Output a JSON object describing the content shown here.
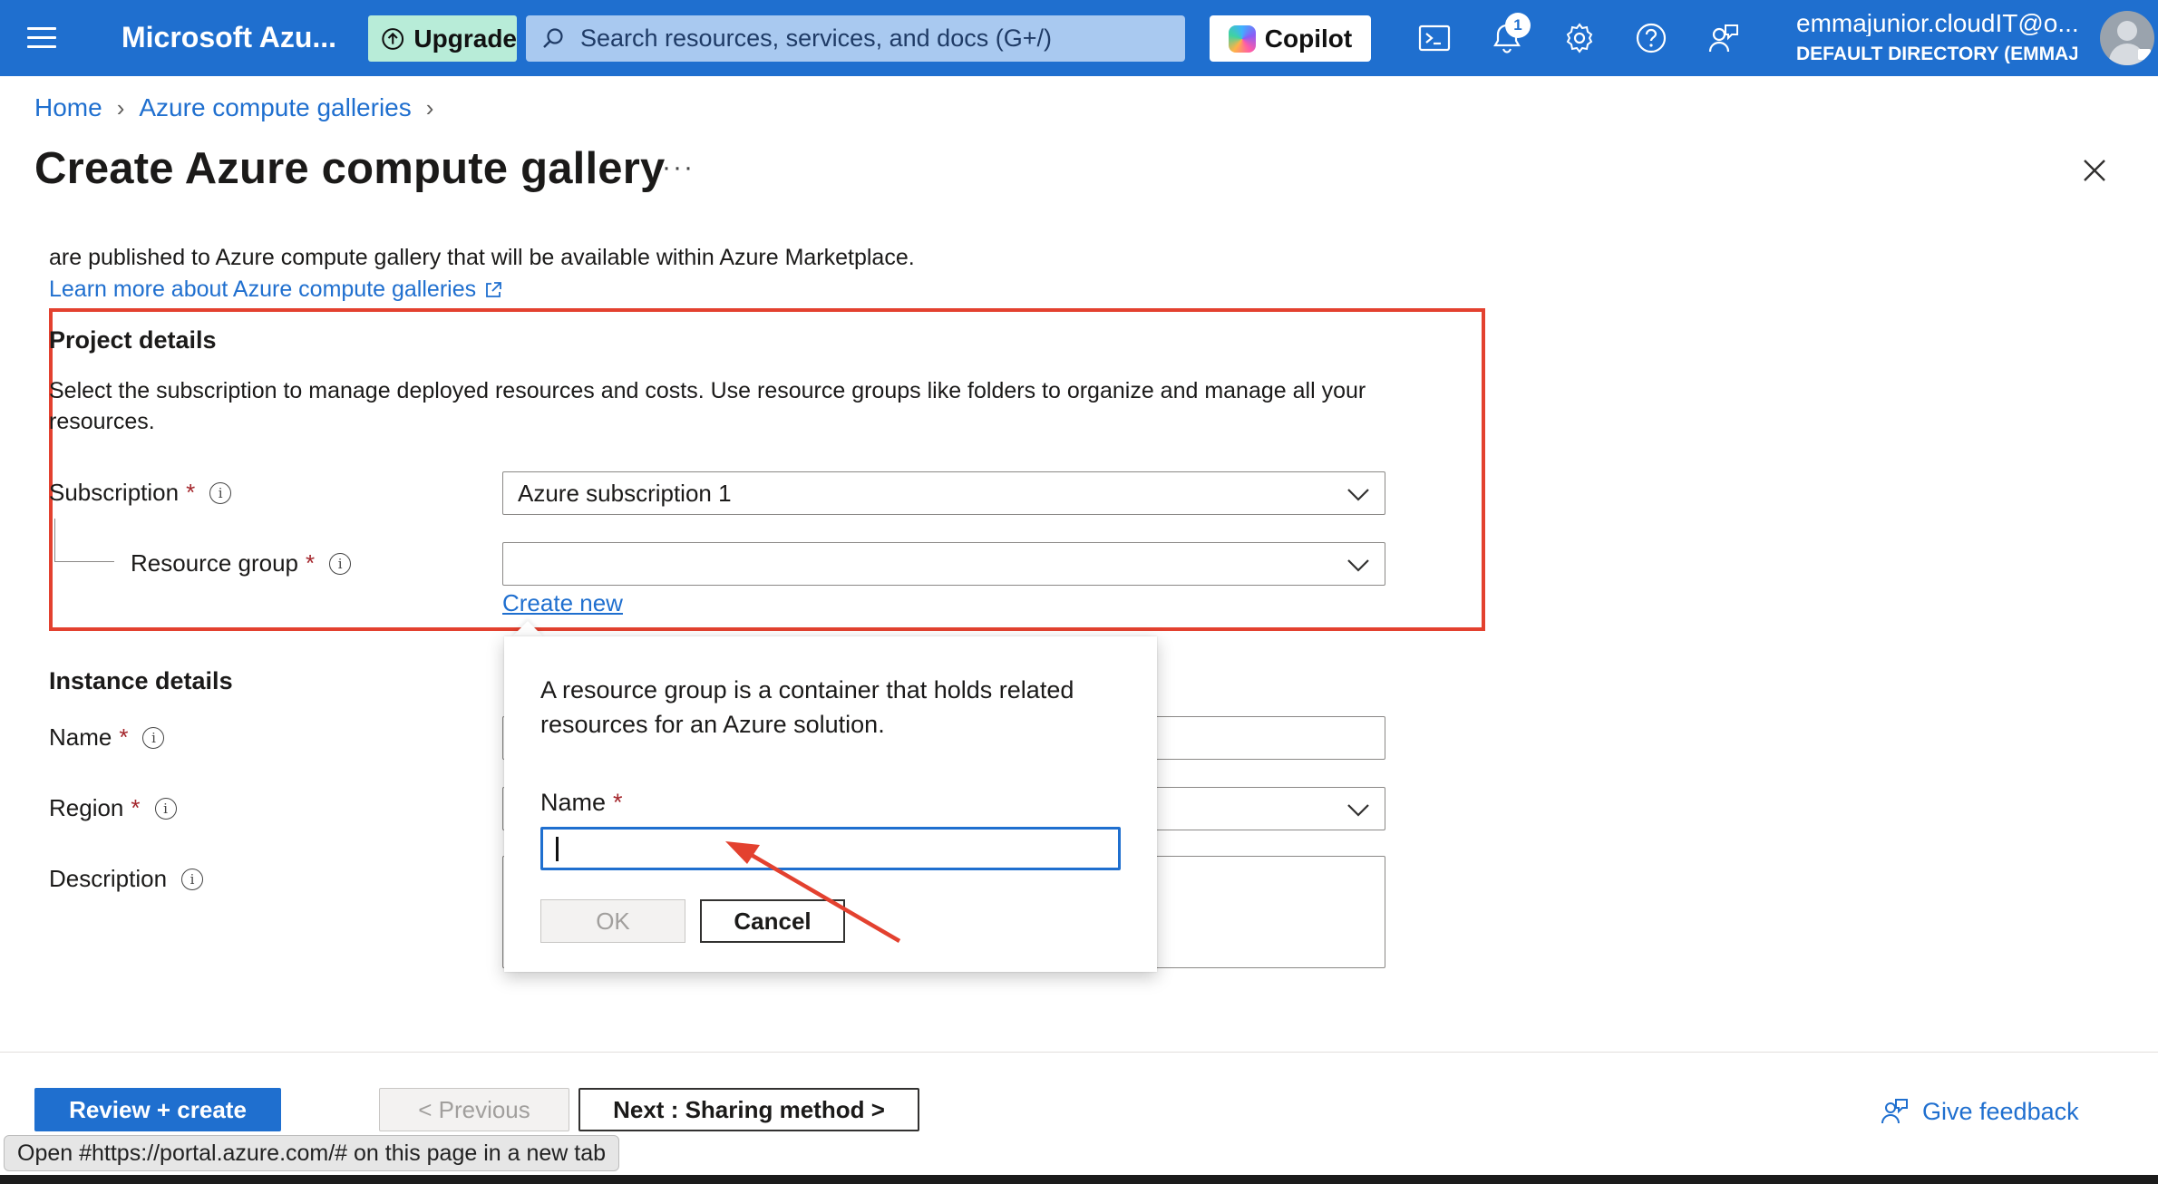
{
  "topbar": {
    "brand": "Microsoft Azu...",
    "upgrade_label": "Upgrade",
    "search_placeholder": "Search resources, services, and docs (G+/)",
    "copilot_label": "Copilot",
    "notification_count": "1",
    "account_name": "emmajunior.cloudIT@o...",
    "account_directory": "DEFAULT DIRECTORY (EMMAJU..."
  },
  "breadcrumb": {
    "items": [
      "Home",
      "Azure compute galleries"
    ]
  },
  "page": {
    "title": "Create Azure compute gallery",
    "more": "···",
    "intro": "are published to Azure compute gallery that will be available within Azure Marketplace.",
    "learn_more": "Learn more about Azure compute galleries"
  },
  "project": {
    "heading": "Project details",
    "description": "Select the subscription to manage deployed resources and costs. Use resource groups like folders to organize and manage all your resources.",
    "subscription_label": "Subscription",
    "subscription_value": "Azure subscription 1",
    "resource_group_label": "Resource group",
    "resource_group_value": "",
    "create_new": "Create new"
  },
  "instance": {
    "heading": "Instance details",
    "name_label": "Name",
    "region_label": "Region",
    "description_label": "Description"
  },
  "popup": {
    "text": "A resource group is a container that holds related resources for an Azure solution.",
    "name_label": "Name",
    "name_value": "",
    "ok_label": "OK",
    "cancel_label": "Cancel"
  },
  "footer": {
    "review_label": "Review + create",
    "previous_label": "< Previous",
    "next_label": "Next : Sharing method >",
    "feedback_label": "Give feedback",
    "status_tooltip": "Open #https://portal.azure.com/# on this page in a new tab"
  },
  "colors": {
    "azure_blue": "#1f6fcf",
    "highlight_red": "#e3412f",
    "required_red": "#a4262c"
  }
}
